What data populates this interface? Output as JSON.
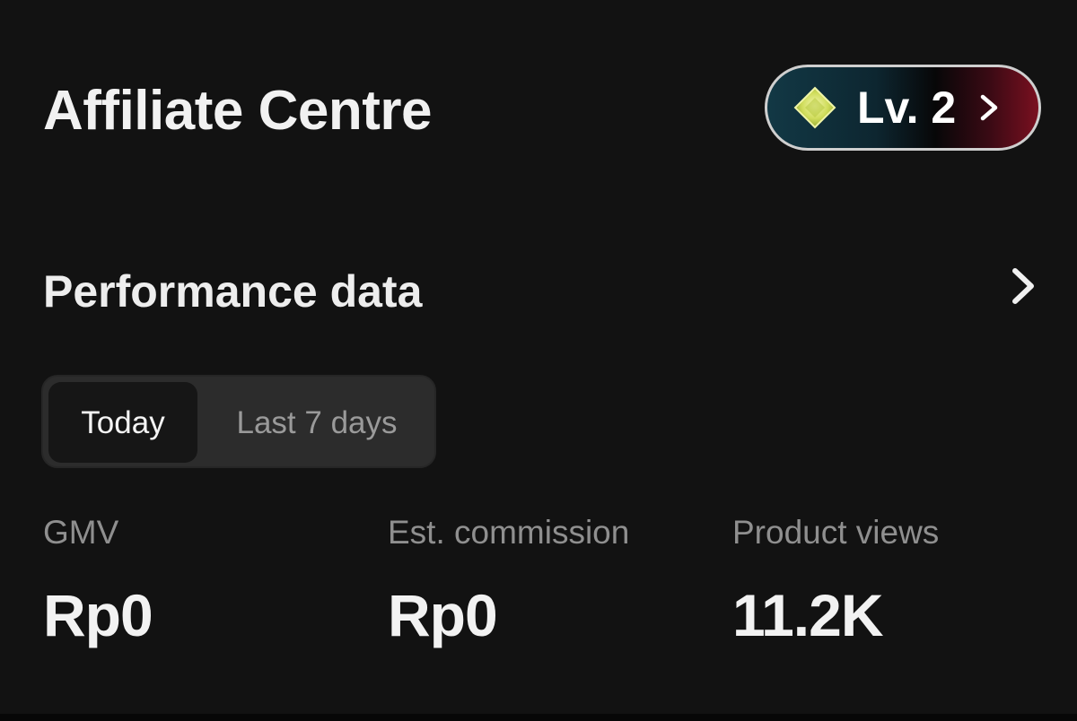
{
  "header": {
    "title": "Affiliate Centre",
    "level_badge": {
      "label": "Lv. 2",
      "icon": "diamond-gem-icon",
      "chevron_icon": "chevron-right-icon"
    }
  },
  "performance": {
    "title": "Performance data",
    "chevron_icon": "chevron-right-icon",
    "tabs": [
      {
        "label": "Today",
        "active": true
      },
      {
        "label": "Last 7 days",
        "active": false
      }
    ],
    "metrics": [
      {
        "label": "GMV",
        "value": "Rp0"
      },
      {
        "label": "Est. commission",
        "value": "Rp0"
      },
      {
        "label": "Product views",
        "value": "11.2K"
      }
    ]
  },
  "colors": {
    "background": "#121212",
    "text_primary": "#ececec",
    "text_secondary": "#8f8f8f",
    "segmented_bg": "#2c2c2c",
    "segmented_active_bg": "#161616",
    "badge_gradient_start": "#123845",
    "badge_gradient_end": "#7a1020",
    "gem": "#d8e26a"
  }
}
